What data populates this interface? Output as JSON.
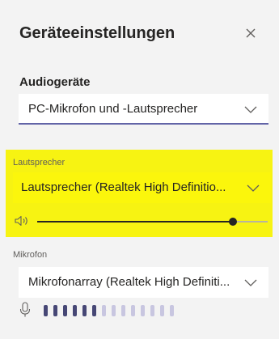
{
  "dialog": {
    "title": "Geräteeinstellungen",
    "close_icon": "close-icon"
  },
  "audio": {
    "section_title": "Audiogeräte",
    "device_value": "PC-Mikrofon und -Lautsprecher"
  },
  "speaker": {
    "label": "Lautsprecher",
    "device_value": "Lautsprecher (Realtek High Definitio...",
    "volume_fraction": 0.85,
    "icon": "speaker-volume-icon"
  },
  "microphone": {
    "label": "Mikrofon",
    "device_value": "Mikrofonarray (Realtek High Definiti...",
    "icon": "microphone-icon",
    "level_bars_total": 14,
    "level_bars_active": 6
  },
  "colors": {
    "accent": "#6264a7",
    "highlight": "#f7f312",
    "meter_active": "#464775",
    "meter_inactive": "#c8c6e0"
  }
}
